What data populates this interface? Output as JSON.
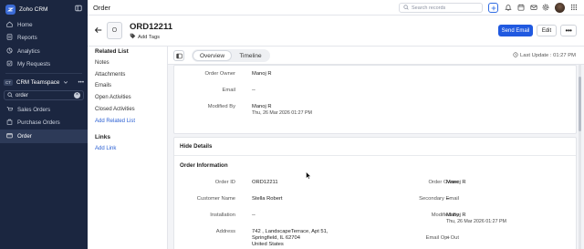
{
  "app": {
    "name": "Zoho CRM"
  },
  "sidebar": {
    "nav": [
      {
        "label": "Home",
        "icon": "home-icon"
      },
      {
        "label": "Reports",
        "icon": "reports-icon"
      },
      {
        "label": "Analytics",
        "icon": "analytics-icon"
      },
      {
        "label": "My Requests",
        "icon": "requests-icon"
      }
    ],
    "team": {
      "badge": "CT",
      "name": "CRM Teamspace"
    },
    "search_value": "order",
    "modules": [
      {
        "label": "Sales Orders",
        "icon": "sales-orders-icon"
      },
      {
        "label": "Purchase Orders",
        "icon": "purchase-orders-icon"
      },
      {
        "label": "Order",
        "icon": "order-icon",
        "active": true
      }
    ]
  },
  "topbar": {
    "title": "Order",
    "search_placeholder": "Search records"
  },
  "record": {
    "icon_letter": "O",
    "title": "ORD12211",
    "add_tags": "Add Tags",
    "send_email": "Send Email",
    "edit": "Edit",
    "more": "•••"
  },
  "related": {
    "heading": "Related List",
    "items": [
      "Notes",
      "Attachments",
      "Emails",
      "Open Activities",
      "Closed Activities"
    ],
    "add_label": "Add Related List",
    "links_heading": "Links",
    "add_link": "Add Link"
  },
  "tabs": {
    "overview": "Overview",
    "timeline": "Timeline",
    "last_update": "Last Update : 01:27 PM"
  },
  "card1": {
    "order_owner_label": "Order Owner",
    "order_owner_value": "Manoj R",
    "email_label": "Email",
    "email_value": "--",
    "modified_by_label": "Modified By",
    "modified_by_name": "Manoj R",
    "modified_by_time": "Thu, 26 Mar 2026 01:27 PM"
  },
  "card2": {
    "hide_details": "Hide Details",
    "section": "Order Information",
    "left": {
      "order_id_label": "Order ID",
      "order_id_value": "ORD12211",
      "customer_label": "Customer Name",
      "customer_value": "Stella Robert",
      "installation_label": "Installation",
      "installation_value": "--",
      "address_label": "Address",
      "address_line1": "742 , LandscapeTerrace, Apt 51,",
      "address_line2": "Springfield, IL 62704",
      "address_line3": "United States"
    },
    "right": {
      "owner_label": "Order Owner",
      "owner_value": "Manoj R",
      "secondary_email_label": "Secondary Email",
      "secondary_email_value": "--",
      "modified_by_label": "Modified By",
      "modified_by_name": "Manoj R",
      "modified_by_time": "Thu, 26 Mar 2026 01:27 PM",
      "email_opt_out_label": "Email Opt Out",
      "email_opt_out_value": "--"
    }
  },
  "colors": {
    "sidebar_bg": "#1b2640",
    "primary": "#2059e0",
    "link": "#2a5fd3"
  }
}
